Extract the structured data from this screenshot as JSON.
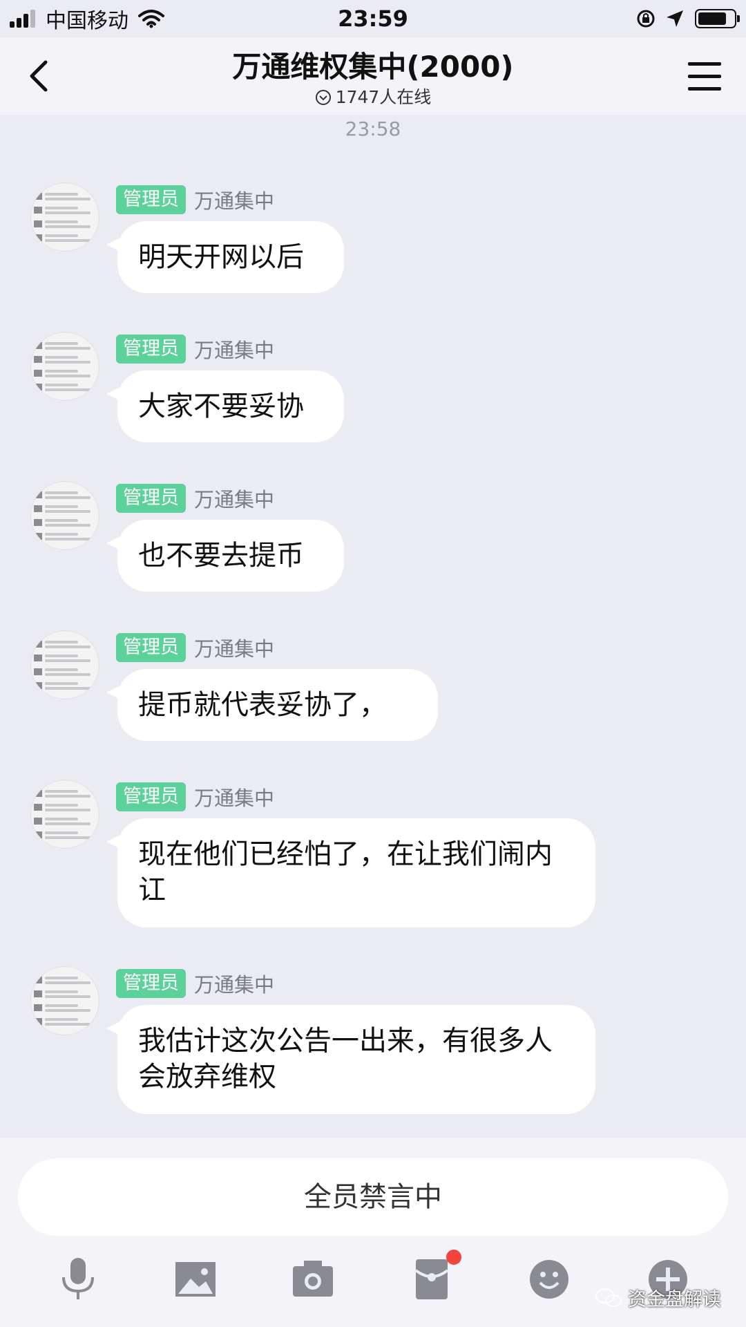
{
  "status_bar": {
    "carrier": "中国移动",
    "time": "23:59"
  },
  "nav": {
    "title": "万通维权集中(2000)",
    "online": "1747人在线"
  },
  "timestamp": "23:58",
  "messages": [
    {
      "role": "管理员",
      "sender": "万通集中",
      "text": "明天开网以后"
    },
    {
      "role": "管理员",
      "sender": "万通集中",
      "text": "大家不要妥协"
    },
    {
      "role": "管理员",
      "sender": "万通集中",
      "text": "也不要去提币"
    },
    {
      "role": "管理员",
      "sender": "万通集中",
      "text": "提币就代表妥协了，"
    },
    {
      "role": "管理员",
      "sender": "万通集中",
      "text": "现在他们已经怕了，在让我们闹内讧"
    },
    {
      "role": "管理员",
      "sender": "万通集中",
      "text": "我估计这次公告一出来，有很多人会放弃维权"
    }
  ],
  "muted_label": "全员禁言中",
  "toolbar": [
    "mic-icon",
    "image-icon",
    "camera-icon",
    "red-packet-icon",
    "emoji-icon",
    "plus-icon"
  ],
  "watermark": "资金盘解读",
  "colors": {
    "badge": "#5cd19b",
    "background": "#ebebf3",
    "notification": "#f2453d"
  }
}
